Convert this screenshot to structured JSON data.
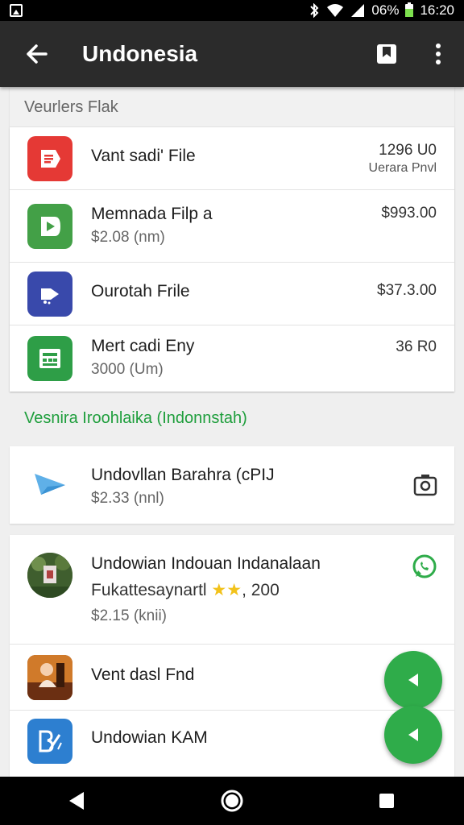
{
  "status_bar": {
    "battery_percent": "06%",
    "time": "16:20",
    "icons": [
      "image-icon",
      "bluetooth-icon",
      "wifi-icon",
      "signal-icon",
      "battery-icon"
    ]
  },
  "app_bar": {
    "title": "Undonesia",
    "icons": [
      "back-arrow-icon",
      "bookmark-icon",
      "more-vert-icon"
    ]
  },
  "section1": {
    "label": "Veurlers Flak",
    "items": [
      {
        "name": "Vant sadi' File",
        "amount": "1296 U0",
        "amount_sub": "Uerara Pnvl",
        "icon": "document-icon",
        "icon_color": "#e53935"
      },
      {
        "name": "Memnada Filp  a",
        "sub": "$2.08 (nm)",
        "amount": "$993.00",
        "icon": "play-icon",
        "icon_color": "#43a047"
      },
      {
        "name": "Ourotah Frile",
        "amount": "$37.3.00",
        "icon": "share-icon",
        "icon_color": "#3949ab"
      },
      {
        "name": "Mert cadi Eny",
        "sub": "3000 (Um)",
        "amount": "36 R0",
        "icon": "calendar-icon",
        "icon_color": "#2e9e47"
      }
    ]
  },
  "section2": {
    "label": "Vesnira Iroohlaika (Indonnstah)",
    "label_color": "#1e9e3c",
    "item": {
      "name": "Undovllan Barahra (cPIJ",
      "sub": "$2.33 (nnl)",
      "icon": "paper-plane-icon",
      "action_icon": "camera-icon"
    }
  },
  "section3": {
    "items": [
      {
        "name": "Undowian Indouan Indanalaan",
        "line2": "Fukattesaynartl",
        "stars": "★★",
        "line2_tail": ", 200",
        "sub": "$2.15 (knii)",
        "icon": "photo-thumbnail",
        "action_icon": "whatsapp-icon"
      },
      {
        "name": "Vent dasl Fnd",
        "icon": "photo-thumbnail"
      },
      {
        "name": "Undowian KAM",
        "icon": "edit-icon",
        "icon_color": "#2d7fd0"
      }
    ]
  },
  "fabs": [
    "send-icon",
    "send-icon"
  ],
  "fab_color": "#2fac4a",
  "nav_bar": {
    "icons": [
      "back-icon",
      "home-icon",
      "recents-icon"
    ]
  }
}
